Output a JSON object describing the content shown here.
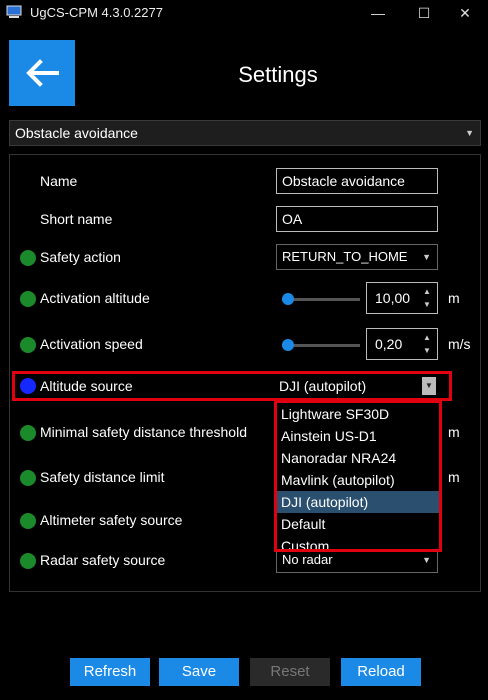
{
  "window": {
    "title": "UgCS-CPM 4.3.0.2277",
    "minimize_glyph": "—",
    "maximize_glyph": "☐",
    "close_glyph": "✕"
  },
  "header": {
    "title": "Settings",
    "back_icon": "arrow-left-icon"
  },
  "main_select": {
    "value": "Obstacle avoidance"
  },
  "fields": {
    "name": {
      "label": "Name",
      "value": "Obstacle avoidance"
    },
    "short_name": {
      "label": "Short name",
      "value": "OA"
    },
    "safety_action": {
      "label": "Safety action",
      "value": "RETURN_TO_HOME",
      "status": "green"
    },
    "activation_altitude": {
      "label": "Activation altitude",
      "value": "10,00",
      "unit": "m",
      "status": "green",
      "slider_fraction": 0.0
    },
    "activation_speed": {
      "label": "Activation speed",
      "value": "0,20",
      "unit": "m/s",
      "status": "green",
      "slider_fraction": 0.0
    },
    "altitude_source": {
      "label": "Altitude source",
      "value": "DJI (autopilot)",
      "status": "blue",
      "options": [
        "Lightware SF30D",
        "Ainstein US-D1",
        "Nanoradar NRA24",
        "Mavlink (autopilot)",
        "DJI (autopilot)",
        "Default",
        "Custom"
      ],
      "selected_index": 4
    },
    "min_safety_distance": {
      "label": "Minimal safety distance threshold",
      "unit": "m",
      "status": "green"
    },
    "safety_distance_limit": {
      "label": "Safety distance limit",
      "unit": "m",
      "status": "green"
    },
    "altimeter_safety_source": {
      "label": "Altimeter safety source",
      "status": "green"
    },
    "radar_safety_source": {
      "label": "Radar safety source",
      "value": "No radar",
      "status": "green"
    }
  },
  "buttons": {
    "refresh": "Refresh",
    "save": "Save",
    "reset": "Reset",
    "reload": "Reload"
  },
  "colors": {
    "accent": "#1a8ae6",
    "highlight": "#e00010",
    "status_green": "#1a8a2a",
    "status_blue": "#1428ff"
  }
}
